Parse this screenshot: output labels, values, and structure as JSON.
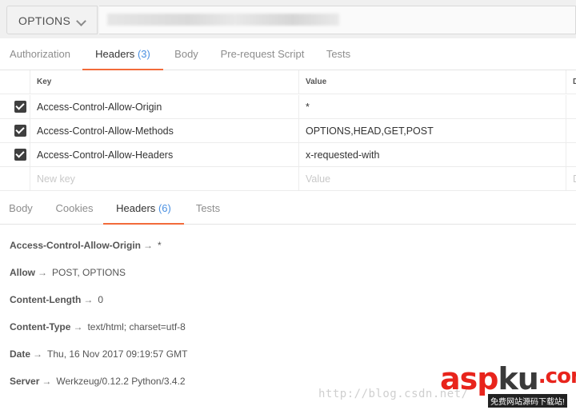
{
  "request": {
    "method": "OPTIONS"
  },
  "request_tabs": [
    {
      "label": "Authorization",
      "count": ""
    },
    {
      "label": "Headers",
      "count": "(3)"
    },
    {
      "label": "Body",
      "count": ""
    },
    {
      "label": "Pre-request Script",
      "count": ""
    },
    {
      "label": "Tests",
      "count": ""
    }
  ],
  "request_headers": {
    "columns": {
      "key": "Key",
      "value": "Value",
      "description": "D"
    },
    "rows": [
      {
        "key": "Access-Control-Allow-Origin",
        "value": "*"
      },
      {
        "key": "Access-Control-Allow-Methods",
        "value": "OPTIONS,HEAD,GET,POST"
      },
      {
        "key": "Access-Control-Allow-Headers",
        "value": "x-requested-with"
      }
    ],
    "new_row": {
      "key_placeholder": "New key",
      "value_placeholder": "Value",
      "description_placeholder": "D"
    }
  },
  "response_tabs": [
    {
      "label": "Body",
      "count": ""
    },
    {
      "label": "Cookies",
      "count": ""
    },
    {
      "label": "Headers",
      "count": "(6)"
    },
    {
      "label": "Tests",
      "count": ""
    }
  ],
  "response_headers": [
    {
      "key": "Access-Control-Allow-Origin",
      "value": "*"
    },
    {
      "key": "Allow",
      "value": "POST, OPTIONS"
    },
    {
      "key": "Content-Length",
      "value": "0"
    },
    {
      "key": "Content-Type",
      "value": "text/html; charset=utf-8"
    },
    {
      "key": "Date",
      "value": "Thu, 16 Nov 2017 09:19:57 GMT"
    },
    {
      "key": "Server",
      "value": "Werkzeug/0.12.2 Python/3.4.2"
    }
  ],
  "arrow": "→",
  "watermark": {
    "url": "http://blog.csdn.net/",
    "logo_a": "asp",
    "logo_b": "ku",
    "logo_c": ".com",
    "sub": "免费网站源码下载站!"
  },
  "colors": {
    "accent": "#f26b3a",
    "count": "#4a90e2"
  },
  "icons": {
    "method_dropdown": "chevron-down-icon",
    "checkbox": "checkbox-checked-icon"
  }
}
